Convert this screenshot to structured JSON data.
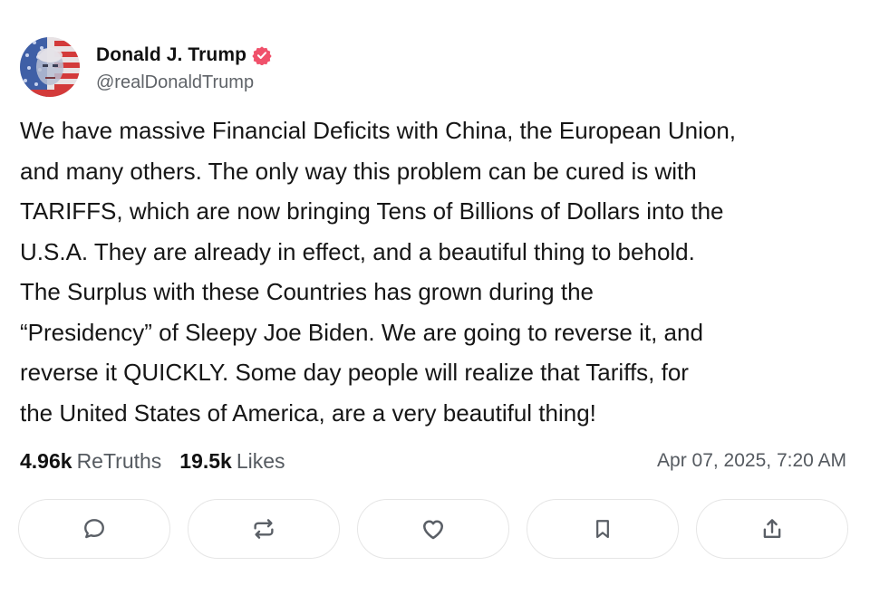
{
  "post": {
    "author": {
      "display_name": "Donald J. Trump",
      "handle": "@realDonaldTrump",
      "verified": true,
      "verified_color": "#f0516b"
    },
    "body_lines": [
      "We have massive Financial Deficits with China, the European Union,",
      "and many others. The only way this problem can be cured is with",
      "TARIFFS, which are now bringing Tens of Billions of Dollars into the",
      "U.S.A. They are already in effect, and a beautiful thing to behold.",
      "The Surplus with these Countries has grown during the",
      "“Presidency” of Sleepy Joe Biden. We are going to reverse it, and",
      "reverse it QUICKLY. Some day people will realize that Tariffs, for",
      "the United States of America, are a very beautiful thing!"
    ],
    "stats": {
      "retruths_count": "4.96k",
      "retruths_label": "ReTruths",
      "likes_count": "19.5k",
      "likes_label": "Likes"
    },
    "timestamp": "Apr 07, 2025, 7:20 AM",
    "actions": [
      {
        "name": "reply",
        "icon": "comment-icon"
      },
      {
        "name": "retruth",
        "icon": "repost-icon"
      },
      {
        "name": "like",
        "icon": "heart-icon"
      },
      {
        "name": "bookmark",
        "icon": "bookmark-icon"
      },
      {
        "name": "share",
        "icon": "share-icon"
      }
    ]
  },
  "colors": {
    "text": "#161616",
    "muted": "#555a60",
    "border": "#e6e6e6",
    "icon": "#5a5f66"
  }
}
